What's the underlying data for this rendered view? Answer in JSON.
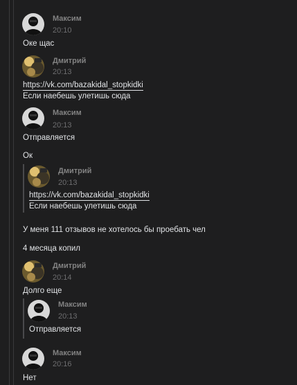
{
  "messages": [
    {
      "author": "Максим",
      "time": "20:10",
      "avatar": "maxim-avatar",
      "lines": [
        "Оке щас"
      ]
    },
    {
      "author": "Дмитрий",
      "time": "20:13",
      "avatar": "dmitry-avatar",
      "link": "https://vk.com/bazakidal_stopkidki",
      "lines": [
        "Если наебешь улетишь сюда"
      ]
    },
    {
      "author": "Максим",
      "time": "20:13",
      "avatar": "maxim-avatar",
      "lines": [
        "Отправляется",
        "Ок"
      ],
      "forwarded": {
        "author": "Дмитрий",
        "time": "20:13",
        "link": "https://vk.com/bazakidal_stopkidki",
        "text": "Если наебешь улетишь сюда"
      },
      "after": [
        "У меня 111 отзывов не хотелось бы проебать чел",
        "4 месяца копил"
      ]
    },
    {
      "author": "Дмитрий",
      "time": "20:14",
      "avatar": "dmitry-avatar",
      "lines": [
        "Долго еще"
      ],
      "forwarded": {
        "author": "Максим",
        "time": "20:13",
        "text": "Отправляется"
      }
    },
    {
      "author": "Максим",
      "time": "20:16",
      "avatar": "maxim-avatar",
      "lines": [
        "Нет"
      ]
    }
  ],
  "colors": {
    "background": "#1e1e1f",
    "text": "#e1e3e6",
    "author": "#828282",
    "time": "#6d6d6f"
  }
}
